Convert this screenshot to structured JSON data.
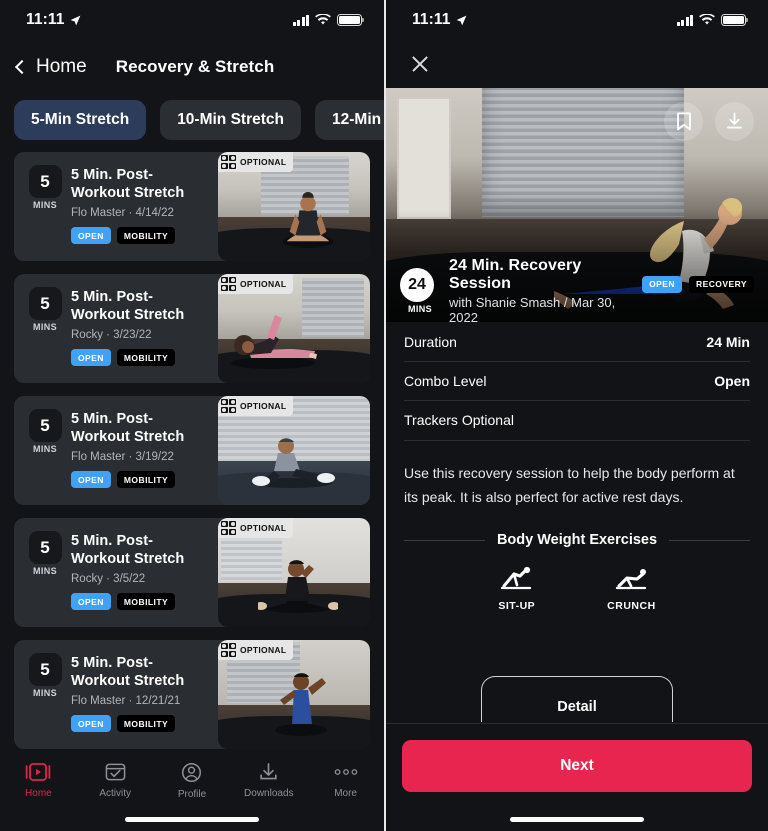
{
  "status_bar": {
    "time": "11:11",
    "location_icon": "location-arrow-icon",
    "signal_icon": "cellular-signal-icon",
    "wifi_icon": "wifi-icon",
    "battery_icon": "battery-full-icon"
  },
  "left_screen": {
    "nav": {
      "back_label": "Home",
      "back_icon": "chevron-left-icon",
      "title": "Recovery & Stretch"
    },
    "filter_chips": [
      {
        "label": "5-Min Stretch",
        "active": true
      },
      {
        "label": "10-Min Stretch",
        "active": false
      },
      {
        "label": "12-Min",
        "active": false
      }
    ],
    "cards": [
      {
        "mins": "5",
        "mins_label": "MINS",
        "title": "5 Min. Post-Workout Stretch",
        "subtitle": "Flo Master · 4/14/22",
        "tag_level": "OPEN",
        "tag_kind": "MOBILITY",
        "optional_label": "OPTIONAL",
        "optional_icon": "tracker-grid-icon"
      },
      {
        "mins": "5",
        "mins_label": "MINS",
        "title": "5 Min. Post-Workout Stretch",
        "subtitle": "Rocky · 3/23/22",
        "tag_level": "OPEN",
        "tag_kind": "MOBILITY",
        "optional_label": "OPTIONAL",
        "optional_icon": "tracker-grid-icon"
      },
      {
        "mins": "5",
        "mins_label": "MINS",
        "title": "5 Min. Post-Workout Stretch",
        "subtitle": "Flo Master · 3/19/22",
        "tag_level": "OPEN",
        "tag_kind": "MOBILITY",
        "optional_label": "OPTIONAL",
        "optional_icon": "tracker-grid-icon"
      },
      {
        "mins": "5",
        "mins_label": "MINS",
        "title": "5 Min. Post-Workout Stretch",
        "subtitle": "Rocky · 3/5/22",
        "tag_level": "OPEN",
        "tag_kind": "MOBILITY",
        "optional_label": "OPTIONAL",
        "optional_icon": "tracker-grid-icon"
      },
      {
        "mins": "5",
        "mins_label": "MINS",
        "title": "5 Min. Post-Workout Stretch",
        "subtitle": "Flo Master · 12/21/21",
        "tag_level": "OPEN",
        "tag_kind": "MOBILITY",
        "optional_label": "OPTIONAL",
        "optional_icon": "tracker-grid-icon"
      }
    ],
    "tab_bar": [
      {
        "label": "Home",
        "icon": "play-home-icon",
        "active": true
      },
      {
        "label": "Activity",
        "icon": "checkmark-calendar-icon",
        "active": false
      },
      {
        "label": "Profile",
        "icon": "person-circle-icon",
        "active": false
      },
      {
        "label": "Downloads",
        "icon": "download-arrow-icon",
        "active": false
      },
      {
        "label": "More",
        "icon": "ellipsis-icon",
        "active": false
      }
    ]
  },
  "right_screen": {
    "close_icon": "close-x-icon",
    "hero": {
      "bookmark_icon": "bookmark-icon",
      "download_icon": "download-icon",
      "mins": "24",
      "mins_label": "MINS",
      "title": "24 Min. Recovery Session",
      "subtitle": "with Shanie Smash / Mar 30, 2022",
      "tag_level": "OPEN",
      "tag_kind": "RECOVERY"
    },
    "detail_rows": [
      {
        "key": "Duration",
        "value": "24 Min"
      },
      {
        "key": "Combo Level",
        "value": "Open"
      },
      {
        "key": "Trackers Optional",
        "value": ""
      }
    ],
    "description": "Use this recovery session to help the body perform at its peak. It is also perfect for active rest days.",
    "section_title": "Body Weight Exercises",
    "exercises": [
      {
        "label": "SIT-UP",
        "icon": "sit-up-icon"
      },
      {
        "label": "CRUNCH",
        "icon": "crunch-icon"
      }
    ],
    "detail_tab_label": "Detail",
    "next_button_label": "Next"
  },
  "colors": {
    "accent_red": "#e8254f",
    "tag_open_blue": "#3fa2f7",
    "chip_active": "#2e3c5c",
    "card_bg": "#2a2d32",
    "screen_bg": "#121417"
  }
}
